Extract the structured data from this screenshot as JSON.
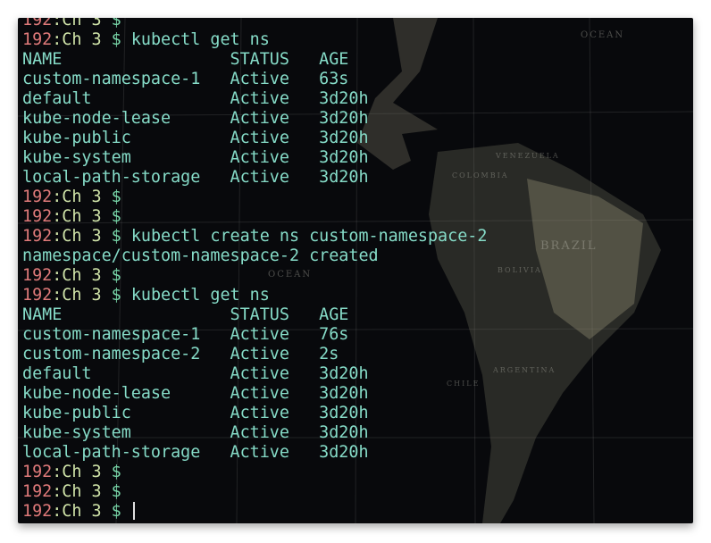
{
  "prompt": {
    "host": "192",
    "dir": ":Ch 3 ",
    "symbol": "$"
  },
  "lines": [
    {
      "type": "prompt",
      "cmd": ""
    },
    {
      "type": "prompt",
      "cmd": "kubectl get ns"
    },
    {
      "type": "out",
      "text": "NAME                 STATUS   AGE"
    },
    {
      "type": "out",
      "text": "custom-namespace-1   Active   63s"
    },
    {
      "type": "out",
      "text": "default              Active   3d20h"
    },
    {
      "type": "out",
      "text": "kube-node-lease      Active   3d20h"
    },
    {
      "type": "out",
      "text": "kube-public          Active   3d20h"
    },
    {
      "type": "out",
      "text": "kube-system          Active   3d20h"
    },
    {
      "type": "out",
      "text": "local-path-storage   Active   3d20h"
    },
    {
      "type": "prompt",
      "cmd": ""
    },
    {
      "type": "prompt",
      "cmd": ""
    },
    {
      "type": "prompt",
      "cmd": "kubectl create ns custom-namespace-2"
    },
    {
      "type": "out",
      "text": "namespace/custom-namespace-2 created"
    },
    {
      "type": "prompt",
      "cmd": ""
    },
    {
      "type": "prompt",
      "cmd": "kubectl get ns"
    },
    {
      "type": "out",
      "text": "NAME                 STATUS   AGE"
    },
    {
      "type": "out",
      "text": "custom-namespace-1   Active   76s"
    },
    {
      "type": "out",
      "text": "custom-namespace-2   Active   2s"
    },
    {
      "type": "out",
      "text": "default              Active   3d20h"
    },
    {
      "type": "out",
      "text": "kube-node-lease      Active   3d20h"
    },
    {
      "type": "out",
      "text": "kube-public          Active   3d20h"
    },
    {
      "type": "out",
      "text": "kube-system          Active   3d20h"
    },
    {
      "type": "out",
      "text": "local-path-storage   Active   3d20h"
    },
    {
      "type": "prompt",
      "cmd": ""
    },
    {
      "type": "prompt",
      "cmd": ""
    },
    {
      "type": "prompt",
      "cmd": "",
      "cursor": true
    }
  ],
  "map_labels": [
    "OCEAN",
    "BRAZIL",
    "COLOMBIA",
    "VENEZUELA",
    "BOLIVIA",
    "ARGENTINA",
    "CHILE",
    "OCEAN"
  ],
  "colors": {
    "background": "#08090c",
    "host": "#e07a7a",
    "dir": "#cfe3a8",
    "dollar": "#78d6a8",
    "text": "#86dcc8"
  }
}
